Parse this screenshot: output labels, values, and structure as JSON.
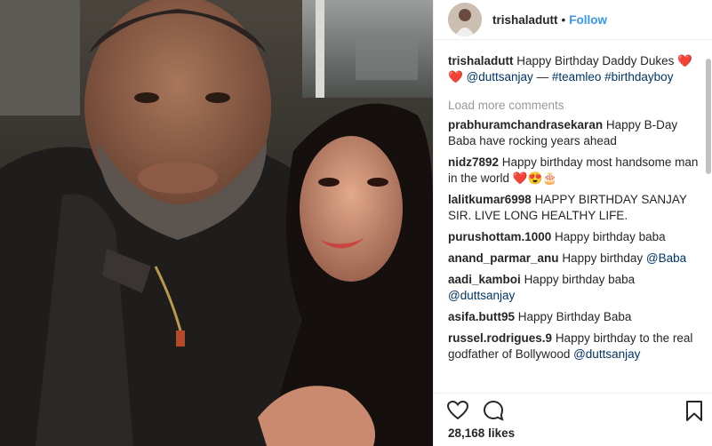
{
  "header": {
    "username": "trishaladutt",
    "separator": "•",
    "follow_label": "Follow"
  },
  "caption": {
    "username": "trishaladutt",
    "text_before": "Happy Birthday Daddy Dukes ❤️❤️ ",
    "mention": "@duttsanjay",
    "dash": " — ",
    "tag1": "#teamleo",
    "tag2": "#birthdayboy"
  },
  "load_more": "Load more comments",
  "comments": [
    {
      "user": "prabhuramchandrasekaran",
      "text": "Happy B-Day Baba have rocking years ahead",
      "mention": ""
    },
    {
      "user": "nidz7892",
      "text": "Happy birthday most handsome man in the world ❤️😍🎂",
      "mention": ""
    },
    {
      "user": "lalitkumar6998",
      "text": "HAPPY BIRTHDAY SANJAY SIR. LIVE LONG HEALTHY LIFE.",
      "mention": ""
    },
    {
      "user": "purushottam.1000",
      "text": "Happy birthday baba",
      "mention": ""
    },
    {
      "user": "anand_parmar_anu",
      "text": "Happy birthday ",
      "mention": "@Baba"
    },
    {
      "user": "aadi_kamboi",
      "text": "Happy birthday baba ",
      "mention": "@duttsanjay"
    },
    {
      "user": "asifa.butt95",
      "text": "Happy Birthday Baba",
      "mention": ""
    },
    {
      "user": "russel.rodrigues.9",
      "text": "Happy birthday to the real godfather of Bollywood ",
      "mention": "@duttsanjay"
    }
  ],
  "likes": {
    "count": "28,168",
    "label": "likes"
  },
  "icons": {
    "like": "heart-icon",
    "comment": "comment-icon",
    "save": "bookmark-icon"
  },
  "colors": {
    "link": "#003569",
    "follow": "#3897f0",
    "muted": "#999999",
    "text": "#262626"
  }
}
